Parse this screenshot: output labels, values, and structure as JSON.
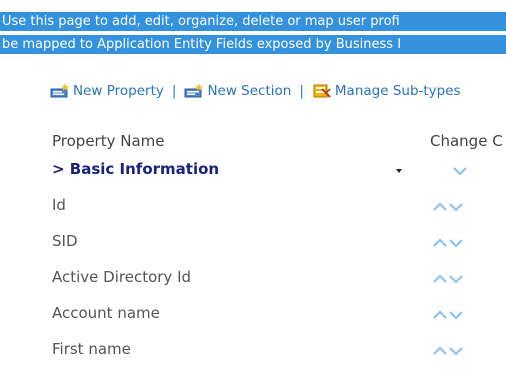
{
  "intro": {
    "line1": "Use this page to add, edit, organize, delete or map user profi",
    "line2": "be mapped to Application Entity Fields exposed by Business I"
  },
  "toolbar": {
    "new_property": "New Property",
    "new_section": "New Section",
    "manage_subtypes": "Manage Sub-types",
    "separator": "|"
  },
  "table": {
    "col_property_name": "Property Name",
    "col_change_order": "Change C",
    "section": {
      "label": "> Basic Information"
    },
    "rows": [
      {
        "name": "Id"
      },
      {
        "name": "SID"
      },
      {
        "name": "Active Directory Id"
      },
      {
        "name": "Account name"
      },
      {
        "name": "First name"
      }
    ]
  },
  "colors": {
    "highlight": "#3391dd",
    "link": "#2b74b8",
    "section_text": "#1a237e",
    "arrow": "#8cc4ef"
  }
}
